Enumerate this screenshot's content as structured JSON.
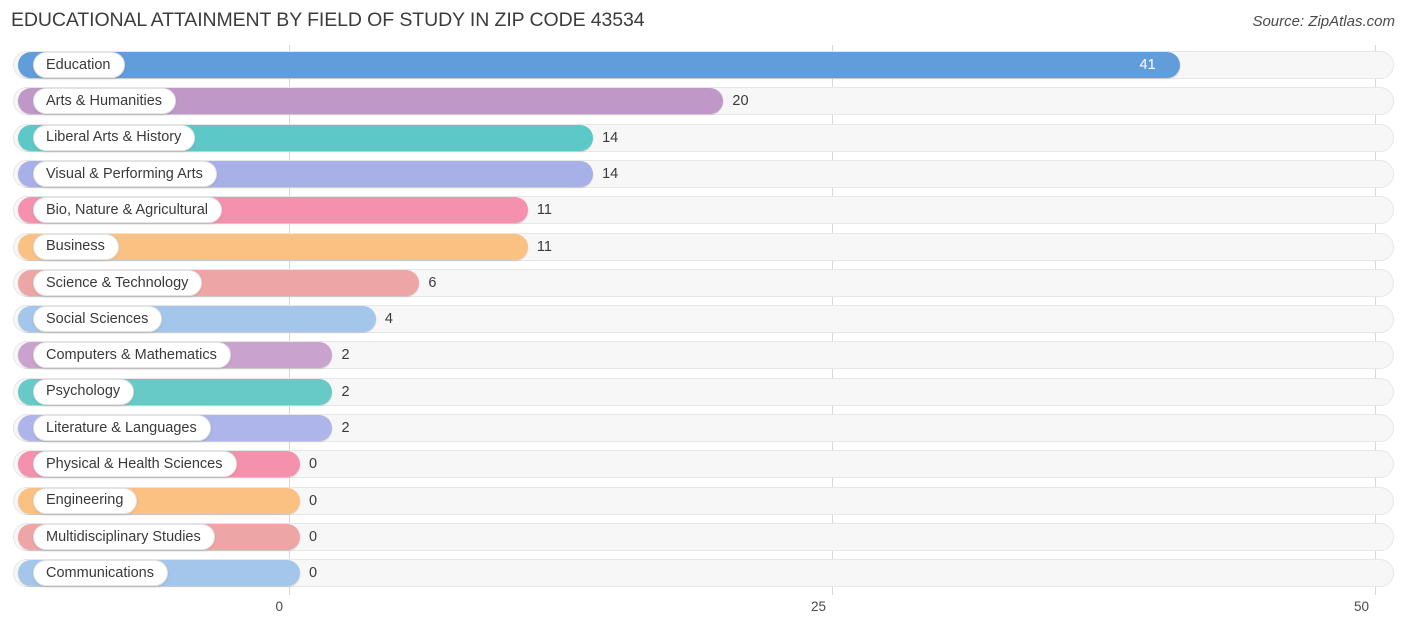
{
  "header": {
    "title": "EDUCATIONAL ATTAINMENT BY FIELD OF STUDY IN ZIP CODE 43534",
    "source": "Source: ZipAtlas.com"
  },
  "axis": {
    "ticks": [
      "0",
      "25",
      "50"
    ]
  },
  "chart_data": {
    "type": "bar",
    "orientation": "horizontal",
    "title": "EDUCATIONAL ATTAINMENT BY FIELD OF STUDY IN ZIP CODE 43534",
    "xlabel": "",
    "ylabel": "",
    "xlim": [
      0,
      50
    ],
    "xticks": [
      0,
      25,
      50
    ],
    "grid": true,
    "legend": false,
    "source": "Source: ZipAtlas.com",
    "categories": [
      "Education",
      "Arts & Humanities",
      "Liberal Arts & History",
      "Visual & Performing Arts",
      "Bio, Nature & Agricultural",
      "Business",
      "Science & Technology",
      "Social Sciences",
      "Computers & Mathematics",
      "Psychology",
      "Literature & Languages",
      "Physical & Health Sciences",
      "Engineering",
      "Multidisciplinary Studies",
      "Communications"
    ],
    "values": [
      41,
      20,
      14,
      14,
      11,
      11,
      6,
      4,
      2,
      2,
      2,
      0,
      0,
      0,
      0
    ],
    "value_labels": [
      "41",
      "20",
      "14",
      "14",
      "11",
      "11",
      "6",
      "4",
      "2",
      "2",
      "2",
      "0",
      "0",
      "0",
      "0"
    ],
    "colors": [
      "#629ddb",
      "#bf98c8",
      "#5cc8c8",
      "#a8b0e8",
      "#f590ae",
      "#fbc183",
      "#eda5a5",
      "#a3c6ea",
      "#c9a2ce",
      "#67cac7",
      "#adb5ea",
      "#f591ad",
      "#fbc183",
      "#eda5a5",
      "#a3c6ea"
    ]
  }
}
